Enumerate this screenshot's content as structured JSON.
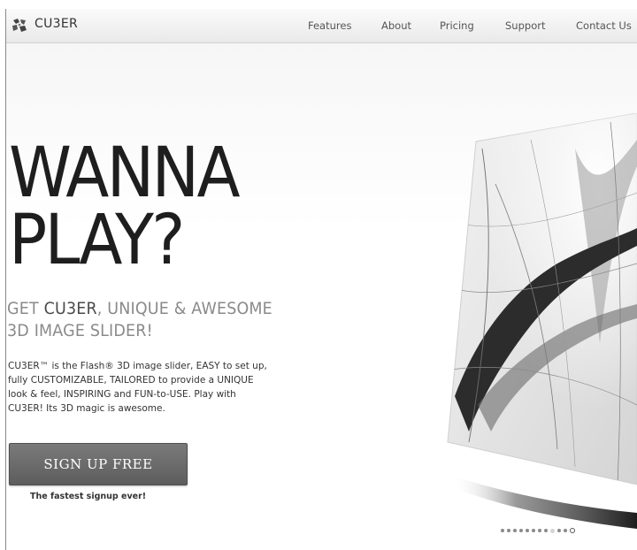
{
  "header": {
    "logo_text": "CU3ER",
    "nav": [
      {
        "label": "Features"
      },
      {
        "label": "About"
      },
      {
        "label": "Pricing"
      },
      {
        "label": "Support"
      },
      {
        "label": "Contact Us"
      }
    ]
  },
  "hero": {
    "headline_line1": "WANNA",
    "headline_line2": "PLAY?",
    "subhead_prefix": "GET ",
    "subhead_brand": "CU3ER",
    "subhead_line1_suffix": ", UNIQUE & AWESOME",
    "subhead_line2": "3D IMAGE SLIDER!",
    "description_lines": [
      "CU3ER™ is the Flash® 3D image slider, EASY to set up,",
      "fully CUSTOMIZABLE, TAILORED to provide a UNIQUE",
      "look & feel, INSPIRING and FUN-to-USE. Play with",
      "CU3ER! Its 3D magic is awesome."
    ],
    "cta_label": "SIGN UP FREE",
    "cta_note": "The fastest signup ever!"
  },
  "slider": {
    "dot_count": 12,
    "active_dot_index": 8
  }
}
